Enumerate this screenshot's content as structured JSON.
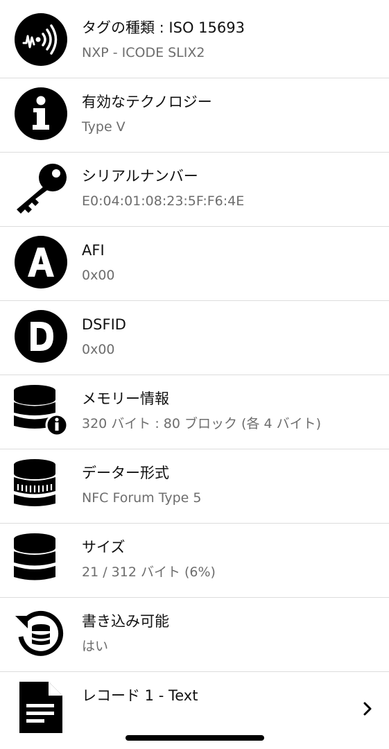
{
  "rows": [
    {
      "icon": "nfc-signal-icon",
      "title": "タグの種類 : ISO 15693",
      "value": "NXP - ICODE SLIX2"
    },
    {
      "icon": "info-icon",
      "title": "有効なテクノロジー",
      "value": "Type V"
    },
    {
      "icon": "key-icon",
      "title": "シリアルナンバー",
      "value": "E0:04:01:08:23:5F:F6:4E"
    },
    {
      "icon": "letter-a-icon",
      "title": "AFI",
      "value": "0x00"
    },
    {
      "icon": "letter-d-icon",
      "title": "DSFID",
      "value": "0x00"
    },
    {
      "icon": "database-info-icon",
      "title": "メモリー情報",
      "value": "320 バイト : 80 ブロック (各 4 バイト)"
    },
    {
      "icon": "database-format-icon",
      "title": "データー形式",
      "value": "NFC Forum Type 5"
    },
    {
      "icon": "database-icon",
      "title": "サイズ",
      "value": "21 / 312 バイト (6%)"
    },
    {
      "icon": "database-rewrite-icon",
      "title": "書き込み可能",
      "value": "はい"
    },
    {
      "icon": "document-icon",
      "title": "レコード 1 - Text",
      "value": "",
      "chevron": "chevron-right-icon"
    }
  ],
  "colors": {
    "background": "#ffffff",
    "title_text": "#111111",
    "value_text": "#6d6d6d",
    "divider": "#dcdcdc",
    "icon": "#000000"
  }
}
